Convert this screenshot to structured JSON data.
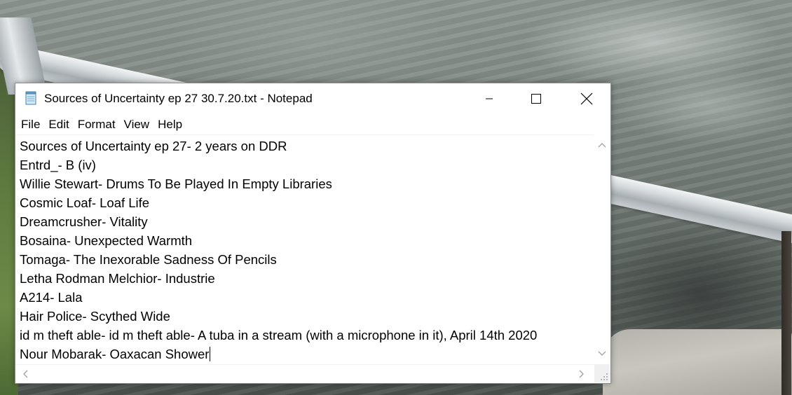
{
  "window": {
    "title": "Sources of Uncertainty ep 27 30.7.20.txt - Notepad",
    "icon": "notepad-icon"
  },
  "menu": [
    "File",
    "Edit",
    "Format",
    "View",
    "Help"
  ],
  "document": {
    "lines": [
      "Sources of Uncertainty ep 27- 2 years on DDR",
      "Entrd_- B (iv)",
      "Willie Stewart- Drums To Be Played In Empty Libraries",
      "Cosmic Loaf- Loaf Life",
      "Dreamcrusher- Vitality",
      "Bosaina- Unexpected Warmth",
      "Tomaga- The Inexorable Sadness Of Pencils",
      "Letha Rodman Melchior- Industrie",
      "A214- Lala",
      "Hair Police- Scythed Wide",
      "id m theft able- id m theft able- A tuba in a stream (with a microphone in it), April 14th 2020",
      "Nour Mobarak- Oaxacan Shower"
    ]
  },
  "colors": {
    "window_bg": "#ffffff",
    "text": "#000000",
    "scroll_arrow": "#a0a0a0"
  }
}
